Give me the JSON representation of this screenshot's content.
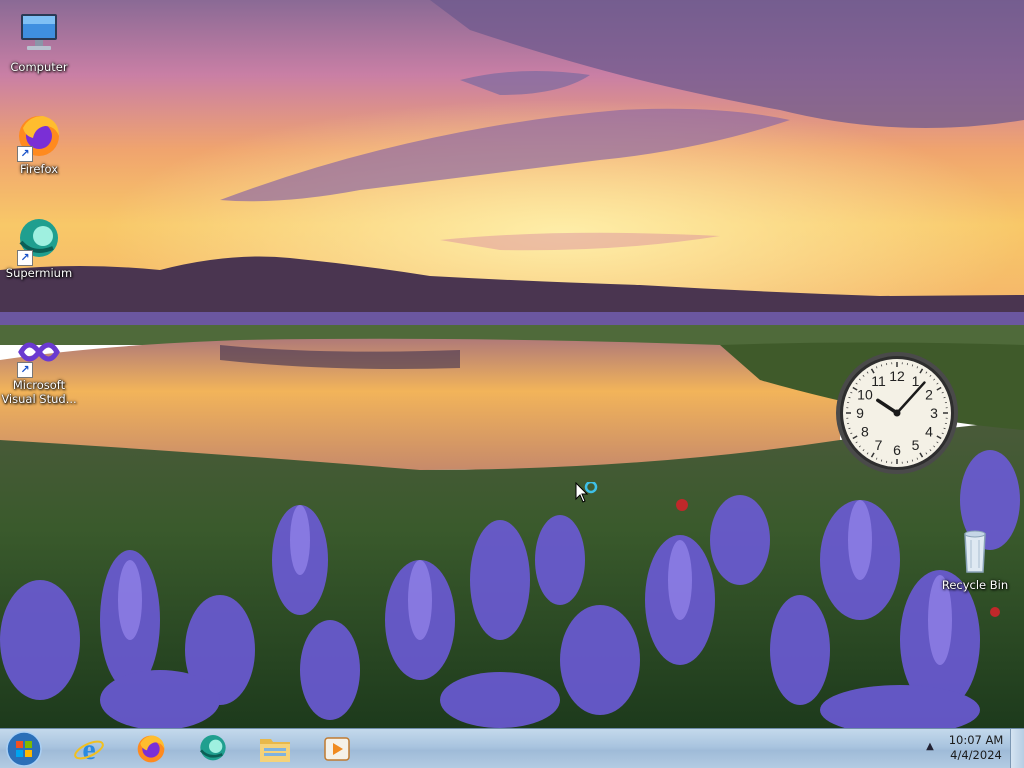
{
  "desktop": {
    "icons": [
      {
        "label": "Computer",
        "icon": "computer-icon"
      },
      {
        "label": "Firefox",
        "icon": "firefox-icon"
      },
      {
        "label": "Supermium",
        "icon": "supermium-icon"
      },
      {
        "label": "Microsoft Visual Stud...",
        "icon": "visual-studio-icon"
      },
      {
        "label": "Recycle Bin",
        "icon": "recycle-bin-icon"
      }
    ]
  },
  "gadget": {
    "clock": {
      "numerals": [
        "12",
        "1",
        "2",
        "3",
        "4",
        "5",
        "6",
        "7",
        "8",
        "9",
        "10",
        "11"
      ],
      "hour": 10,
      "minute": 7
    }
  },
  "taskbar": {
    "start": {
      "icon": "windows-start-icon"
    },
    "pinned": [
      {
        "name": "Internet Explorer",
        "icon": "internet-explorer-icon"
      },
      {
        "name": "Firefox",
        "icon": "firefox-icon"
      },
      {
        "name": "Supermium",
        "icon": "supermium-icon"
      },
      {
        "name": "File Explorer",
        "icon": "folder-icon"
      },
      {
        "name": "Media Player",
        "icon": "media-player-icon"
      }
    ],
    "tray": {
      "arrow": "▲",
      "time": "10:07 AM",
      "date": "4/4/2024"
    }
  },
  "colors": {
    "taskbar": "#a9c4df",
    "sky_top": "#8a6a9a",
    "sunset": "#f7c45a",
    "flowers": "#6b5ad6"
  }
}
